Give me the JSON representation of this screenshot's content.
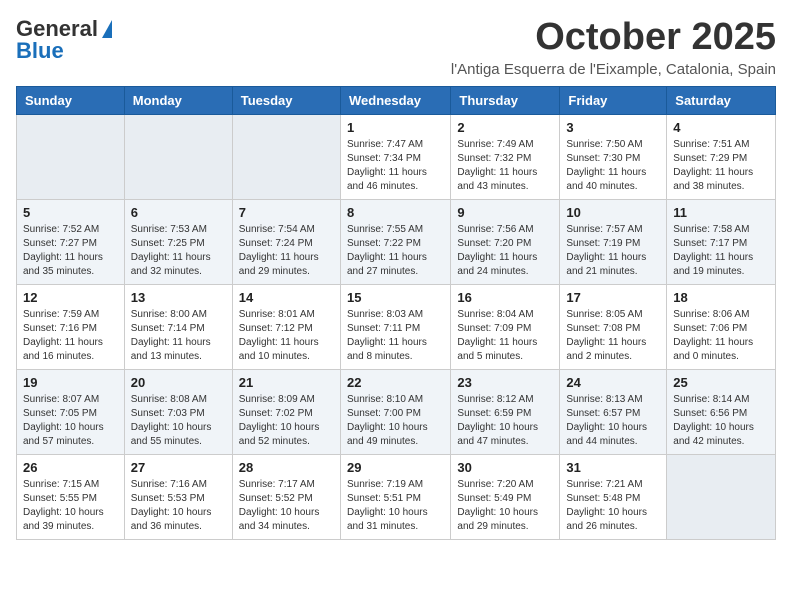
{
  "header": {
    "logo_general": "General",
    "logo_blue": "Blue",
    "month_title": "October 2025",
    "location": "l'Antiga Esquerra de l'Eixample, Catalonia, Spain"
  },
  "weekdays": [
    "Sunday",
    "Monday",
    "Tuesday",
    "Wednesday",
    "Thursday",
    "Friday",
    "Saturday"
  ],
  "weeks": [
    [
      {
        "day": "",
        "sunrise": "",
        "sunset": "",
        "daylight": ""
      },
      {
        "day": "",
        "sunrise": "",
        "sunset": "",
        "daylight": ""
      },
      {
        "day": "",
        "sunrise": "",
        "sunset": "",
        "daylight": ""
      },
      {
        "day": "1",
        "sunrise": "Sunrise: 7:47 AM",
        "sunset": "Sunset: 7:34 PM",
        "daylight": "Daylight: 11 hours and 46 minutes."
      },
      {
        "day": "2",
        "sunrise": "Sunrise: 7:49 AM",
        "sunset": "Sunset: 7:32 PM",
        "daylight": "Daylight: 11 hours and 43 minutes."
      },
      {
        "day": "3",
        "sunrise": "Sunrise: 7:50 AM",
        "sunset": "Sunset: 7:30 PM",
        "daylight": "Daylight: 11 hours and 40 minutes."
      },
      {
        "day": "4",
        "sunrise": "Sunrise: 7:51 AM",
        "sunset": "Sunset: 7:29 PM",
        "daylight": "Daylight: 11 hours and 38 minutes."
      }
    ],
    [
      {
        "day": "5",
        "sunrise": "Sunrise: 7:52 AM",
        "sunset": "Sunset: 7:27 PM",
        "daylight": "Daylight: 11 hours and 35 minutes."
      },
      {
        "day": "6",
        "sunrise": "Sunrise: 7:53 AM",
        "sunset": "Sunset: 7:25 PM",
        "daylight": "Daylight: 11 hours and 32 minutes."
      },
      {
        "day": "7",
        "sunrise": "Sunrise: 7:54 AM",
        "sunset": "Sunset: 7:24 PM",
        "daylight": "Daylight: 11 hours and 29 minutes."
      },
      {
        "day": "8",
        "sunrise": "Sunrise: 7:55 AM",
        "sunset": "Sunset: 7:22 PM",
        "daylight": "Daylight: 11 hours and 27 minutes."
      },
      {
        "day": "9",
        "sunrise": "Sunrise: 7:56 AM",
        "sunset": "Sunset: 7:20 PM",
        "daylight": "Daylight: 11 hours and 24 minutes."
      },
      {
        "day": "10",
        "sunrise": "Sunrise: 7:57 AM",
        "sunset": "Sunset: 7:19 PM",
        "daylight": "Daylight: 11 hours and 21 minutes."
      },
      {
        "day": "11",
        "sunrise": "Sunrise: 7:58 AM",
        "sunset": "Sunset: 7:17 PM",
        "daylight": "Daylight: 11 hours and 19 minutes."
      }
    ],
    [
      {
        "day": "12",
        "sunrise": "Sunrise: 7:59 AM",
        "sunset": "Sunset: 7:16 PM",
        "daylight": "Daylight: 11 hours and 16 minutes."
      },
      {
        "day": "13",
        "sunrise": "Sunrise: 8:00 AM",
        "sunset": "Sunset: 7:14 PM",
        "daylight": "Daylight: 11 hours and 13 minutes."
      },
      {
        "day": "14",
        "sunrise": "Sunrise: 8:01 AM",
        "sunset": "Sunset: 7:12 PM",
        "daylight": "Daylight: 11 hours and 10 minutes."
      },
      {
        "day": "15",
        "sunrise": "Sunrise: 8:03 AM",
        "sunset": "Sunset: 7:11 PM",
        "daylight": "Daylight: 11 hours and 8 minutes."
      },
      {
        "day": "16",
        "sunrise": "Sunrise: 8:04 AM",
        "sunset": "Sunset: 7:09 PM",
        "daylight": "Daylight: 11 hours and 5 minutes."
      },
      {
        "day": "17",
        "sunrise": "Sunrise: 8:05 AM",
        "sunset": "Sunset: 7:08 PM",
        "daylight": "Daylight: 11 hours and 2 minutes."
      },
      {
        "day": "18",
        "sunrise": "Sunrise: 8:06 AM",
        "sunset": "Sunset: 7:06 PM",
        "daylight": "Daylight: 11 hours and 0 minutes."
      }
    ],
    [
      {
        "day": "19",
        "sunrise": "Sunrise: 8:07 AM",
        "sunset": "Sunset: 7:05 PM",
        "daylight": "Daylight: 10 hours and 57 minutes."
      },
      {
        "day": "20",
        "sunrise": "Sunrise: 8:08 AM",
        "sunset": "Sunset: 7:03 PM",
        "daylight": "Daylight: 10 hours and 55 minutes."
      },
      {
        "day": "21",
        "sunrise": "Sunrise: 8:09 AM",
        "sunset": "Sunset: 7:02 PM",
        "daylight": "Daylight: 10 hours and 52 minutes."
      },
      {
        "day": "22",
        "sunrise": "Sunrise: 8:10 AM",
        "sunset": "Sunset: 7:00 PM",
        "daylight": "Daylight: 10 hours and 49 minutes."
      },
      {
        "day": "23",
        "sunrise": "Sunrise: 8:12 AM",
        "sunset": "Sunset: 6:59 PM",
        "daylight": "Daylight: 10 hours and 47 minutes."
      },
      {
        "day": "24",
        "sunrise": "Sunrise: 8:13 AM",
        "sunset": "Sunset: 6:57 PM",
        "daylight": "Daylight: 10 hours and 44 minutes."
      },
      {
        "day": "25",
        "sunrise": "Sunrise: 8:14 AM",
        "sunset": "Sunset: 6:56 PM",
        "daylight": "Daylight: 10 hours and 42 minutes."
      }
    ],
    [
      {
        "day": "26",
        "sunrise": "Sunrise: 7:15 AM",
        "sunset": "Sunset: 5:55 PM",
        "daylight": "Daylight: 10 hours and 39 minutes."
      },
      {
        "day": "27",
        "sunrise": "Sunrise: 7:16 AM",
        "sunset": "Sunset: 5:53 PM",
        "daylight": "Daylight: 10 hours and 36 minutes."
      },
      {
        "day": "28",
        "sunrise": "Sunrise: 7:17 AM",
        "sunset": "Sunset: 5:52 PM",
        "daylight": "Daylight: 10 hours and 34 minutes."
      },
      {
        "day": "29",
        "sunrise": "Sunrise: 7:19 AM",
        "sunset": "Sunset: 5:51 PM",
        "daylight": "Daylight: 10 hours and 31 minutes."
      },
      {
        "day": "30",
        "sunrise": "Sunrise: 7:20 AM",
        "sunset": "Sunset: 5:49 PM",
        "daylight": "Daylight: 10 hours and 29 minutes."
      },
      {
        "day": "31",
        "sunrise": "Sunrise: 7:21 AM",
        "sunset": "Sunset: 5:48 PM",
        "daylight": "Daylight: 10 hours and 26 minutes."
      },
      {
        "day": "",
        "sunrise": "",
        "sunset": "",
        "daylight": ""
      }
    ]
  ]
}
